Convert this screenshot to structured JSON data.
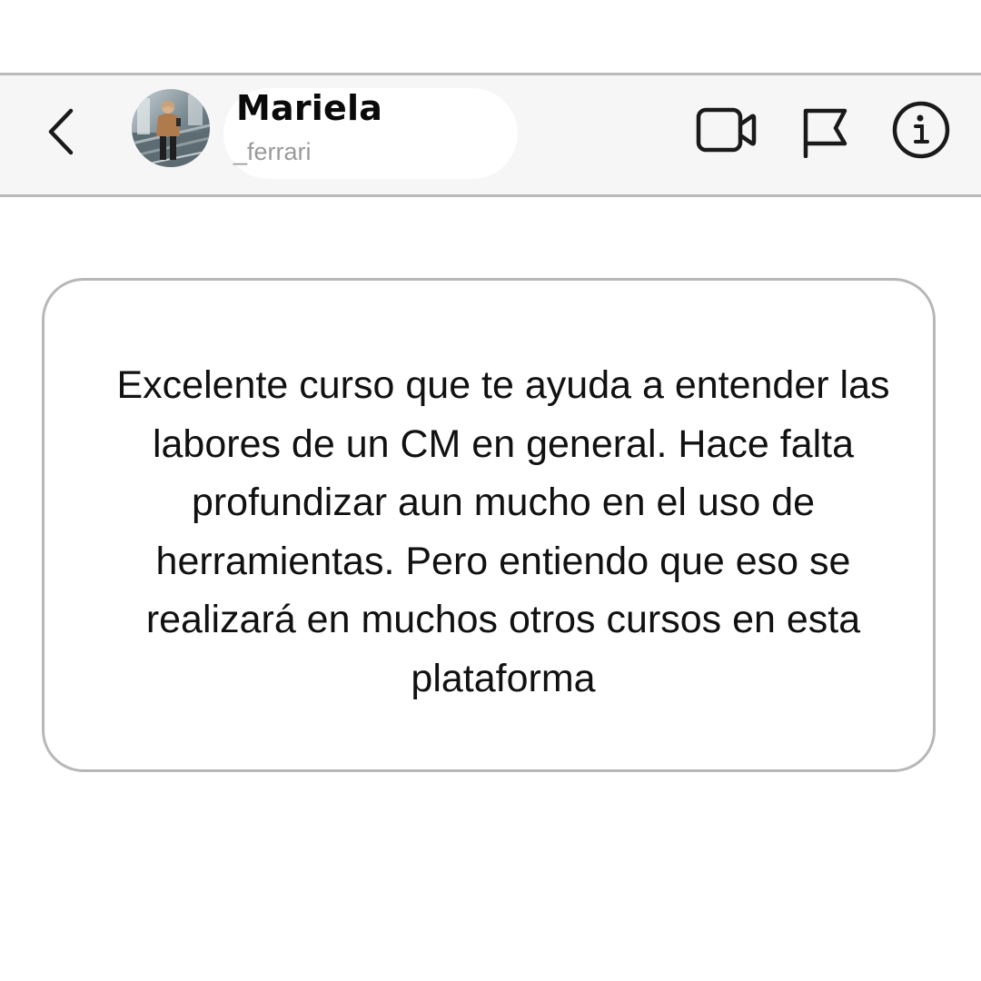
{
  "header": {
    "contact_name": "Mariela",
    "contact_handle": "_ferrari",
    "icons": {
      "back": "chevron-left-icon",
      "video": "video-camera-icon",
      "flag": "flag-icon",
      "info": "info-icon"
    }
  },
  "message": {
    "text": "Excelente curso que te ayuda a entender las labores de un CM en general. Hace falta profundizar aun mucho en el uso de herramientas. Pero entiendo que eso se realizará en muchos otros cursos en esta plataforma"
  },
  "colors": {
    "header_background": "#f6f6f6",
    "border": "#b9b9b9",
    "text": "#111111",
    "handle_text": "#9a9a9a"
  }
}
